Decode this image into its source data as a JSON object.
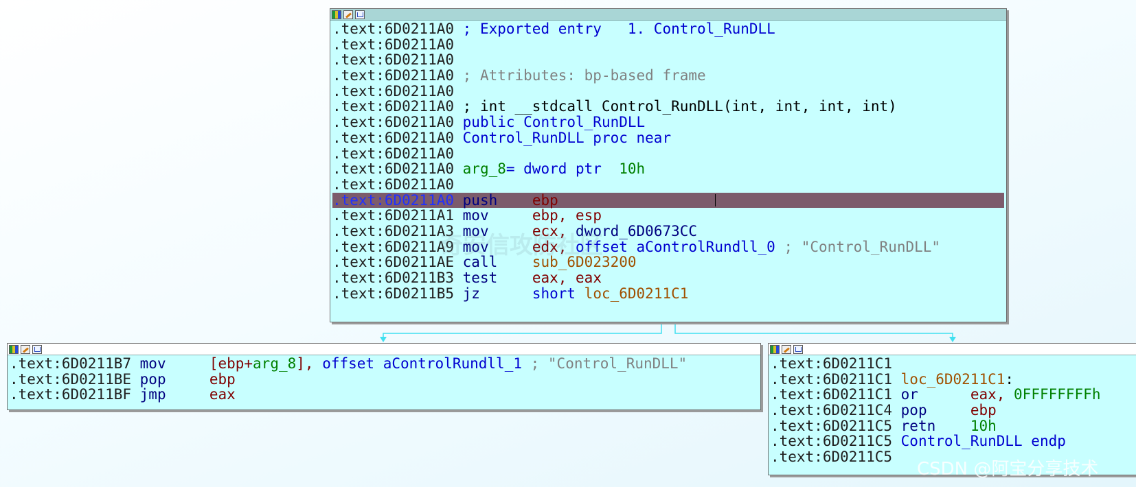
{
  "top_block": {
    "lines": [
      {
        "addr": ".text:6D0211A0",
        "t1": " ; Exported entry   1. Control_RunDLL",
        "t2": "",
        "t3": "",
        "t4": ""
      },
      {
        "addr": ".text:6D0211A0",
        "t1": "",
        "t2": "",
        "t3": "",
        "t4": ""
      },
      {
        "addr": ".text:6D0211A0",
        "t1": "",
        "t2": "",
        "t3": "",
        "t4": ""
      },
      {
        "addr": ".text:6D0211A0",
        "t1": " ; Attributes: bp-based frame",
        "t2": "",
        "t3": "",
        "t4": ""
      },
      {
        "addr": ".text:6D0211A0",
        "t1": "",
        "t2": "",
        "t3": "",
        "t4": ""
      },
      {
        "addr": ".text:6D0211A0",
        "t1": " ; int __stdcall Control_RunDLL(int, int, int, int)",
        "t2": "",
        "t3": "",
        "t4": ""
      },
      {
        "addr": ".text:6D0211A0",
        "t1": " public Control_RunDLL",
        "t2": "",
        "t3": "",
        "t4": ""
      },
      {
        "addr": ".text:6D0211A0",
        "t1": " Control_RunDLL proc near",
        "t2": "",
        "t3": "",
        "t4": ""
      },
      {
        "addr": ".text:6D0211A0",
        "t1": "",
        "t2": "",
        "t3": "",
        "t4": ""
      },
      {
        "addr": ".text:6D0211A0",
        "t1": " arg_8",
        "t2": "= dword ptr  ",
        "t3": "10h",
        "t4": ""
      },
      {
        "addr": ".text:6D0211A0",
        "t1": "",
        "t2": "",
        "t3": "",
        "t4": ""
      },
      {
        "addr": ".text:6D0211A0",
        "t1": " push    ",
        "t2": "ebp",
        "t3": "",
        "t4": ""
      },
      {
        "addr": ".text:6D0211A1",
        "t1": " mov     ",
        "t2": "ebp, esp",
        "t3": "",
        "t4": ""
      },
      {
        "addr": ".text:6D0211A3",
        "t1": " mov     ",
        "t2": "ecx, ",
        "t3": "dword_6D0673CC",
        "t4": ""
      },
      {
        "addr": ".text:6D0211A9",
        "t1": " mov     ",
        "t2": "edx, ",
        "t3": "offset aControlRundll_0",
        "t4": " ; \"Control_RunDLL\""
      },
      {
        "addr": ".text:6D0211AE",
        "t1": " call    ",
        "t2": "sub_6D023200",
        "t3": "",
        "t4": ""
      },
      {
        "addr": ".text:6D0211B3",
        "t1": " test    ",
        "t2": "eax, eax",
        "t3": "",
        "t4": ""
      },
      {
        "addr": ".text:6D0211B5",
        "t1": " jz      ",
        "t2": "short ",
        "t3": "loc_6D0211C1",
        "t4": ""
      }
    ]
  },
  "left_block": {
    "lines": [
      {
        "addr": ".text:6D0211B7",
        "t1": " mov     ",
        "t2": "[ebp+",
        "t3": "arg_8",
        "t4": "], ",
        "t5": "offset aControlRundll_1",
        "t6": " ; \"Control_RunDLL\""
      },
      {
        "addr": ".text:6D0211BE",
        "t1": " pop     ",
        "t2": "ebp",
        "t3": "",
        "t4": "",
        "t5": "",
        "t6": ""
      },
      {
        "addr": ".text:6D0211BF",
        "t1": " jmp     ",
        "t2": "eax",
        "t3": "",
        "t4": "",
        "t5": "",
        "t6": ""
      }
    ]
  },
  "right_block": {
    "lines": [
      {
        "addr": ".text:6D0211C1",
        "t1": "",
        "t2": "",
        "t3": ""
      },
      {
        "addr": ".text:6D0211C1",
        "t1": " loc_6D0211C1",
        "t2": ":",
        "t3": ""
      },
      {
        "addr": ".text:6D0211C1",
        "t1": " or      ",
        "t2": "eax, ",
        "t3": "0FFFFFFFFh"
      },
      {
        "addr": ".text:6D0211C4",
        "t1": " pop     ",
        "t2": "ebp",
        "t3": ""
      },
      {
        "addr": ".text:6D0211C5",
        "t1": " retn    ",
        "t2": "10h",
        "t3": ""
      },
      {
        "addr": ".text:6D0211C5",
        "t1": " Control_RunDLL endp",
        "t2": "",
        "t3": ""
      },
      {
        "addr": ".text:6D0211C5",
        "t1": "",
        "t2": "",
        "t3": ""
      }
    ]
  },
  "watermark": "CSDN @阿宝分享技术",
  "watermark_bg": "奇安信攻防社区",
  "colors": {
    "node_bg": "#c8ffff",
    "selected_line": "#7c5c6c",
    "edge": "#40e0f0",
    "keyword": "#0000d0",
    "register": "#800000",
    "number": "#008000",
    "location": "#a05000",
    "comment": "#808080"
  },
  "icons": [
    "color-palette-icon",
    "edit-node-icon",
    "graph-view-icon"
  ]
}
